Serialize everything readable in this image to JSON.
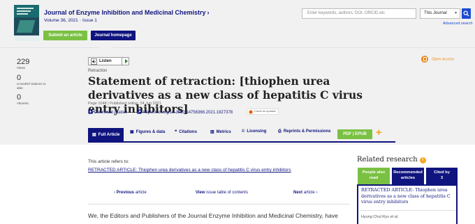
{
  "journal": {
    "title": "Journal of Enzyme Inhibition and Medicinal Chemistry",
    "title_chevron": "›",
    "volume": "Volume 36, 2021",
    "issue_sep": "-",
    "issue": "Issue 1",
    "submit_label": "Submit an article",
    "homepage_label": "Journal homepage"
  },
  "search": {
    "placeholder": "Enter keywords, authors, DOI, ORCID etc",
    "scope": "This Journal",
    "advanced": "Advanced search"
  },
  "metrics": [
    {
      "value": "229",
      "label": "Views"
    },
    {
      "value": "0",
      "label": "CrossRef citations to date"
    },
    {
      "value": "0",
      "label": "Altmetric"
    }
  ],
  "listen": {
    "label": "Listen"
  },
  "article": {
    "type": "Retraction",
    "title": "Statement of retraction: [thiophen urea derivatives as a new class of hepatitis C virus entry inhibitors]",
    "page_info": "Page 1048 | Published online: 24 Jun 2021",
    "download_citation": "Download citation",
    "doi": "https://doi.org/10.1080/14756366.2021.1927378",
    "check_updates": "Check for updates",
    "open_access": "Open access"
  },
  "tabs": [
    {
      "label": "Full Article",
      "icon": "document-icon"
    },
    {
      "label": "Figures & data",
      "icon": "image-icon"
    },
    {
      "label": "Citations",
      "icon": "quote-icon"
    },
    {
      "label": "Metrics",
      "icon": "bar-chart-icon"
    },
    {
      "label": "Licensing",
      "icon": "copyright-icon"
    },
    {
      "label": "Reprints & Permissions",
      "icon": "print-icon"
    }
  ],
  "pdf_label": "PDF | EPUB",
  "content": {
    "refers_to": "This article refers to:",
    "retracted_link": "RETRACTED ARTICLE: Thiophen urea derivatives as a new class of hepatitis C virus entry inhibitors",
    "prev_bold": "Previous",
    "prev_rest": " article",
    "toc_bold": "View",
    "toc_rest": " issue table of contents",
    "next_bold": "Next",
    "next_rest": " article",
    "body": "We, the Editors and Publishers of the Journal Enzyme Inhibition and Medicinal Chemistry, have"
  },
  "related": {
    "title": "Related research",
    "tabs": [
      {
        "line1": "People also",
        "line2": "read"
      },
      {
        "line1": "Recommended",
        "line2": "articles"
      },
      {
        "line1": "Cited by",
        "line2": "3"
      }
    ],
    "item_title": "RETRACTED ARTICLE: Thiophen urea derivatives as a new class of hepatitis C virus entry inhibitors",
    "item_authors": "Hyung Chul Ryu et al."
  },
  "colors": {
    "navy": "#10147e",
    "green": "#7ac143",
    "orange": "#f5a623",
    "link_blue": "#1b4bd1"
  }
}
